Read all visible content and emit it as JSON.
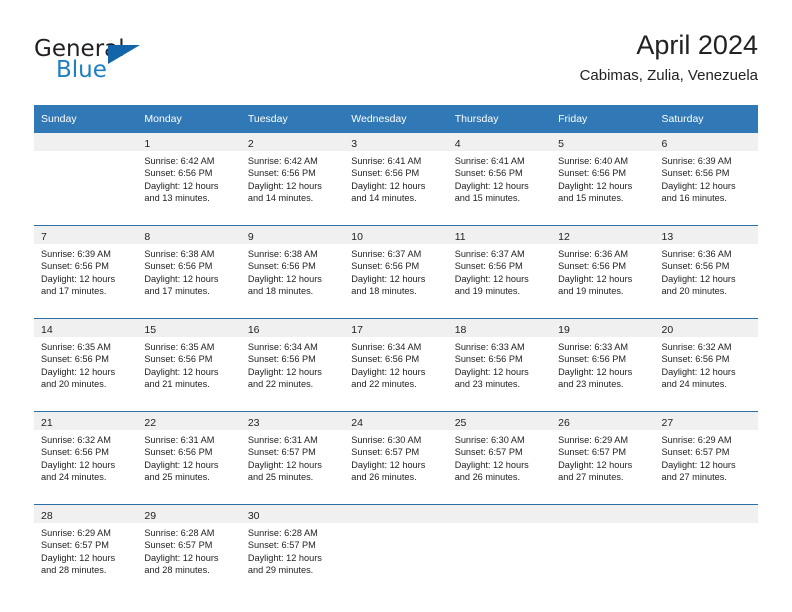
{
  "brand": {
    "name_top": "General",
    "name_bottom": "Blue",
    "triangle_icon": "triangle-icon",
    "color_dark": "#231f20",
    "color_blue": "#1f7fc4",
    "color_triangle": "#1265a8"
  },
  "header": {
    "title": "April 2024",
    "location": "Cabimas, Zulia, Venezuela"
  },
  "theme": {
    "header_bg": "#3179b6",
    "daynum_band": "#f0f0f0",
    "separator": "#2f6fa8",
    "text": "#222222"
  },
  "weekday_headers": [
    "Sunday",
    "Monday",
    "Tuesday",
    "Wednesday",
    "Thursday",
    "Friday",
    "Saturday"
  ],
  "weeks": [
    {
      "days": [
        {
          "num": "",
          "lines": []
        },
        {
          "num": "1",
          "lines": [
            "Sunrise: 6:42 AM",
            "Sunset: 6:56 PM",
            "Daylight: 12 hours",
            "and 13 minutes."
          ]
        },
        {
          "num": "2",
          "lines": [
            "Sunrise: 6:42 AM",
            "Sunset: 6:56 PM",
            "Daylight: 12 hours",
            "and 14 minutes."
          ]
        },
        {
          "num": "3",
          "lines": [
            "Sunrise: 6:41 AM",
            "Sunset: 6:56 PM",
            "Daylight: 12 hours",
            "and 14 minutes."
          ]
        },
        {
          "num": "4",
          "lines": [
            "Sunrise: 6:41 AM",
            "Sunset: 6:56 PM",
            "Daylight: 12 hours",
            "and 15 minutes."
          ]
        },
        {
          "num": "5",
          "lines": [
            "Sunrise: 6:40 AM",
            "Sunset: 6:56 PM",
            "Daylight: 12 hours",
            "and 15 minutes."
          ]
        },
        {
          "num": "6",
          "lines": [
            "Sunrise: 6:39 AM",
            "Sunset: 6:56 PM",
            "Daylight: 12 hours",
            "and 16 minutes."
          ]
        }
      ]
    },
    {
      "days": [
        {
          "num": "7",
          "lines": [
            "Sunrise: 6:39 AM",
            "Sunset: 6:56 PM",
            "Daylight: 12 hours",
            "and 17 minutes."
          ]
        },
        {
          "num": "8",
          "lines": [
            "Sunrise: 6:38 AM",
            "Sunset: 6:56 PM",
            "Daylight: 12 hours",
            "and 17 minutes."
          ]
        },
        {
          "num": "9",
          "lines": [
            "Sunrise: 6:38 AM",
            "Sunset: 6:56 PM",
            "Daylight: 12 hours",
            "and 18 minutes."
          ]
        },
        {
          "num": "10",
          "lines": [
            "Sunrise: 6:37 AM",
            "Sunset: 6:56 PM",
            "Daylight: 12 hours",
            "and 18 minutes."
          ]
        },
        {
          "num": "11",
          "lines": [
            "Sunrise: 6:37 AM",
            "Sunset: 6:56 PM",
            "Daylight: 12 hours",
            "and 19 minutes."
          ]
        },
        {
          "num": "12",
          "lines": [
            "Sunrise: 6:36 AM",
            "Sunset: 6:56 PM",
            "Daylight: 12 hours",
            "and 19 minutes."
          ]
        },
        {
          "num": "13",
          "lines": [
            "Sunrise: 6:36 AM",
            "Sunset: 6:56 PM",
            "Daylight: 12 hours",
            "and 20 minutes."
          ]
        }
      ]
    },
    {
      "days": [
        {
          "num": "14",
          "lines": [
            "Sunrise: 6:35 AM",
            "Sunset: 6:56 PM",
            "Daylight: 12 hours",
            "and 20 minutes."
          ]
        },
        {
          "num": "15",
          "lines": [
            "Sunrise: 6:35 AM",
            "Sunset: 6:56 PM",
            "Daylight: 12 hours",
            "and 21 minutes."
          ]
        },
        {
          "num": "16",
          "lines": [
            "Sunrise: 6:34 AM",
            "Sunset: 6:56 PM",
            "Daylight: 12 hours",
            "and 22 minutes."
          ]
        },
        {
          "num": "17",
          "lines": [
            "Sunrise: 6:34 AM",
            "Sunset: 6:56 PM",
            "Daylight: 12 hours",
            "and 22 minutes."
          ]
        },
        {
          "num": "18",
          "lines": [
            "Sunrise: 6:33 AM",
            "Sunset: 6:56 PM",
            "Daylight: 12 hours",
            "and 23 minutes."
          ]
        },
        {
          "num": "19",
          "lines": [
            "Sunrise: 6:33 AM",
            "Sunset: 6:56 PM",
            "Daylight: 12 hours",
            "and 23 minutes."
          ]
        },
        {
          "num": "20",
          "lines": [
            "Sunrise: 6:32 AM",
            "Sunset: 6:56 PM",
            "Daylight: 12 hours",
            "and 24 minutes."
          ]
        }
      ]
    },
    {
      "days": [
        {
          "num": "21",
          "lines": [
            "Sunrise: 6:32 AM",
            "Sunset: 6:56 PM",
            "Daylight: 12 hours",
            "and 24 minutes."
          ]
        },
        {
          "num": "22",
          "lines": [
            "Sunrise: 6:31 AM",
            "Sunset: 6:56 PM",
            "Daylight: 12 hours",
            "and 25 minutes."
          ]
        },
        {
          "num": "23",
          "lines": [
            "Sunrise: 6:31 AM",
            "Sunset: 6:57 PM",
            "Daylight: 12 hours",
            "and 25 minutes."
          ]
        },
        {
          "num": "24",
          "lines": [
            "Sunrise: 6:30 AM",
            "Sunset: 6:57 PM",
            "Daylight: 12 hours",
            "and 26 minutes."
          ]
        },
        {
          "num": "25",
          "lines": [
            "Sunrise: 6:30 AM",
            "Sunset: 6:57 PM",
            "Daylight: 12 hours",
            "and 26 minutes."
          ]
        },
        {
          "num": "26",
          "lines": [
            "Sunrise: 6:29 AM",
            "Sunset: 6:57 PM",
            "Daylight: 12 hours",
            "and 27 minutes."
          ]
        },
        {
          "num": "27",
          "lines": [
            "Sunrise: 6:29 AM",
            "Sunset: 6:57 PM",
            "Daylight: 12 hours",
            "and 27 minutes."
          ]
        }
      ]
    },
    {
      "days": [
        {
          "num": "28",
          "lines": [
            "Sunrise: 6:29 AM",
            "Sunset: 6:57 PM",
            "Daylight: 12 hours",
            "and 28 minutes."
          ]
        },
        {
          "num": "29",
          "lines": [
            "Sunrise: 6:28 AM",
            "Sunset: 6:57 PM",
            "Daylight: 12 hours",
            "and 28 minutes."
          ]
        },
        {
          "num": "30",
          "lines": [
            "Sunrise: 6:28 AM",
            "Sunset: 6:57 PM",
            "Daylight: 12 hours",
            "and 29 minutes."
          ]
        },
        {
          "num": "",
          "lines": []
        },
        {
          "num": "",
          "lines": []
        },
        {
          "num": "",
          "lines": []
        },
        {
          "num": "",
          "lines": []
        }
      ]
    }
  ]
}
